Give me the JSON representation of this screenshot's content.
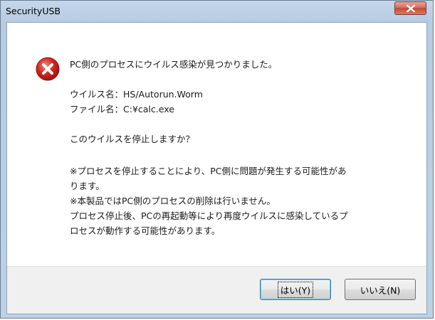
{
  "window": {
    "title": "SecurityUSB"
  },
  "message": {
    "icon": "error-icon",
    "headline": "PC側のプロセスにウイルス感染が見つかりました。",
    "virus_name_line": "ウイルス名：HS/Autorun.Worm",
    "file_name_line": "ファイル名：C:¥calc.exe",
    "question": "このウイルスを停止しますか？",
    "note_1_line1": "※プロセスを停止することにより、PC側に問題が発生する可能性があ",
    "note_1_line2": "ります。",
    "note_2": "※本製品ではPC側のプロセスの削除は行いません。",
    "note_3_line1": "プロセス停止後、PCの再起動等により再度ウイルスに感染しているプ",
    "note_3_line2": "ロセスが動作する可能性があります。"
  },
  "buttons": {
    "yes_label": "はい(Y)",
    "no_label": "いいえ(N)"
  },
  "colors": {
    "error_red": "#d0281e",
    "titlebar": "#b9cde4",
    "close_button": "#c9584a"
  }
}
